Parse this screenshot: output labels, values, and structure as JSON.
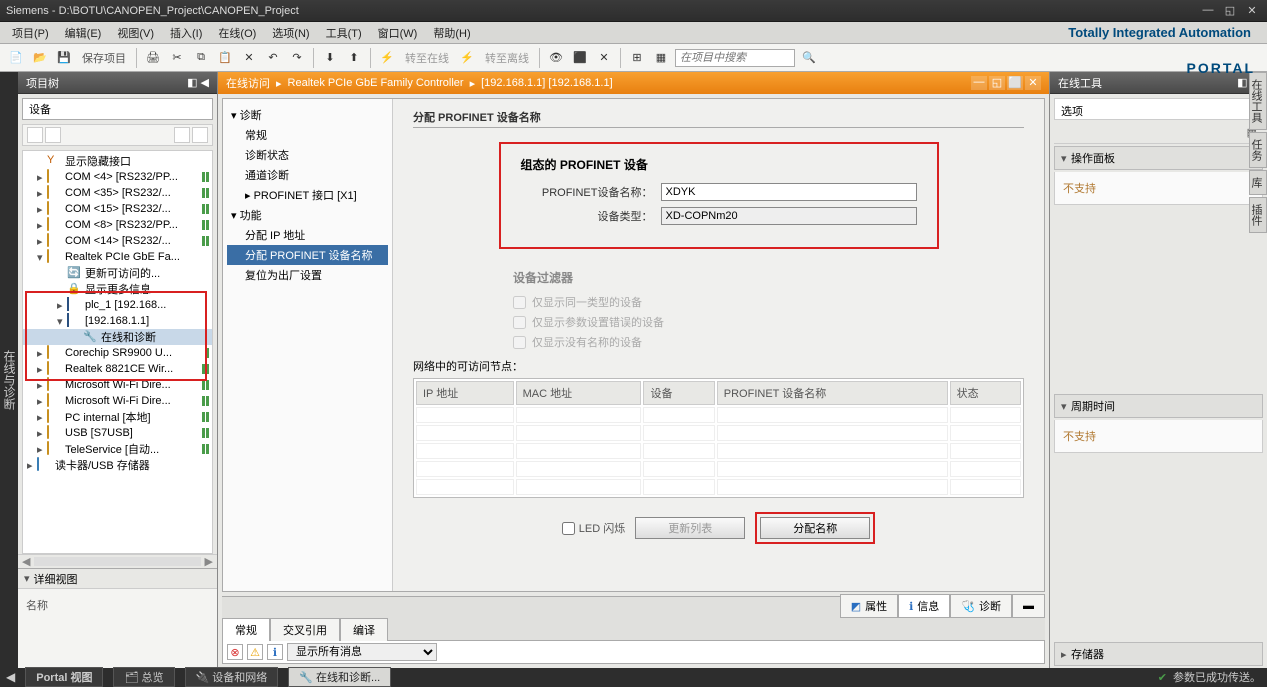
{
  "title": "Siemens  -  D:\\BOTU\\CANOPEN_Project\\CANOPEN_Project",
  "brand": "Totally Integrated Automation",
  "brand_portal": "PORTAL",
  "menu": [
    "项目(P)",
    "编辑(E)",
    "视图(V)",
    "插入(I)",
    "在线(O)",
    "选项(N)",
    "工具(T)",
    "窗口(W)",
    "帮助(H)"
  ],
  "toolbar": {
    "save": "保存项目",
    "go_online": "转至在线",
    "go_offline": "转至离线",
    "search_placeholder": "在项目中搜索"
  },
  "left_rail": "在线与诊断",
  "project_tree_title": "项目树",
  "device_label": "设备",
  "tree_items": {
    "i0": "显示隐藏接口",
    "i1": "COM <4> [RS232/PP...",
    "i2": "COM <35> [RS232/...",
    "i3": "COM <15> [RS232/...",
    "i4": "COM <8> [RS232/PP...",
    "i5": "COM <14> [RS232/...",
    "i6": "Realtek PCIe GbE Fa...",
    "i7": "更新可访问的...",
    "i8": "显示更多信息",
    "i9": "plc_1 [192.168...",
    "i10": "[192.168.1.1]",
    "i11": "在线和诊断",
    "i12": "Corechip SR9900 U...",
    "i13": "Realtek 8821CE Wir...",
    "i14": "Microsoft Wi-Fi Dire...",
    "i15": "Microsoft Wi-Fi Dire...",
    "i16": "PC internal [本地]",
    "i17": "USB [S7USB]",
    "i18": "TeleService [自动...",
    "i19": "读卡器/USB 存储器"
  },
  "detail_view": "详细视图",
  "name_label": "名称",
  "doc_path": {
    "p1": "在线访问",
    "p2": "Realtek PCIe GbE Family Controller",
    "p3": "[192.168.1.1] [192.168.1.1]"
  },
  "nav": {
    "diag": "诊断",
    "general": "常规",
    "diag_status": "诊断状态",
    "channel_diag": "通道诊断",
    "profinet_if": "PROFINET 接口 [X1]",
    "func": "功能",
    "assign_ip": "分配 IP 地址",
    "assign_name": "分配 PROFINET 设备名称",
    "reset": "复位为出厂设置"
  },
  "content": {
    "section": "分配 PROFINET 设备名称",
    "config_title": "组态的 PROFINET 设备",
    "dev_name_label": "PROFINET设备名称：",
    "dev_name": "XDYK",
    "dev_type_label": "设备类型：",
    "dev_type": "XD-COPNm20",
    "filter_title": "设备过滤器",
    "filter1": "仅显示同一类型的设备",
    "filter2": "仅显示参数设置错误的设备",
    "filter3": "仅显示没有名称的设备",
    "nodes_label": "网络中的可访问节点：",
    "col_ip": "IP 地址",
    "col_mac": "MAC 地址",
    "col_dev": "设备",
    "col_pname": "PROFINET 设备名称",
    "col_status": "状态",
    "led": "LED 闪烁",
    "refresh": "更新列表",
    "assign": "分配名称"
  },
  "bottom": {
    "t1": "常规",
    "t2": "交叉引用",
    "t3": "编译",
    "r1": "属性",
    "r2": "信息",
    "r3": "诊断",
    "show_all": "显示所有消息"
  },
  "right": {
    "title": "在线工具",
    "options": "选项",
    "op_panel": "操作面板",
    "unsupported": "不支持",
    "cycle": "周期时间",
    "storage": "存储器"
  },
  "rails": [
    "在线工具",
    "任务",
    "库",
    "插件"
  ],
  "taskbar": {
    "portal": "Portal 视图",
    "overview": "总览",
    "dev_net": "设备和网络",
    "online_diag": "在线和诊断...",
    "status": "参数已成功传送。"
  }
}
